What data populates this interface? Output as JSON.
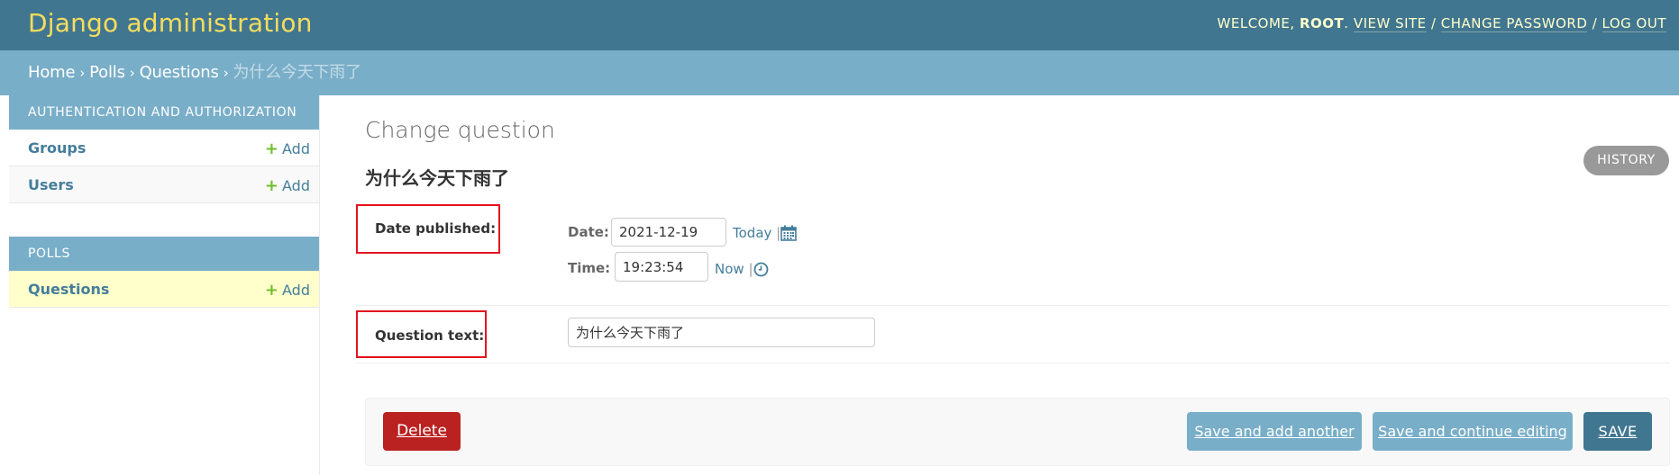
{
  "header": {
    "site_name": "Django administration",
    "welcome": "Welcome,",
    "username": "root",
    "view_site": "View site",
    "change_password": "Change password",
    "log_out": "Log out",
    "slash": "/",
    "period": "."
  },
  "breadcrumbs": {
    "home": "Home",
    "polls": "Polls",
    "questions": "Questions",
    "current": "为什么今天下雨了",
    "separator": "›"
  },
  "sidebar": {
    "modules": [
      {
        "caption": "Authentication and Authorization",
        "rows": [
          {
            "name": "Groups",
            "add": "Add"
          },
          {
            "name": "Users",
            "add": "Add"
          }
        ]
      },
      {
        "caption": "Polls",
        "rows": [
          {
            "name": "Questions",
            "add": "Add"
          }
        ]
      }
    ]
  },
  "main": {
    "title": "Change question",
    "object_name": "为什么今天下雨了",
    "history": "History",
    "fields": {
      "date_published": {
        "label": "Date published:",
        "date_label": "Date:",
        "date_value": "2021-12-19",
        "today": "Today",
        "time_label": "Time:",
        "time_value": "19:23:54",
        "now": "Now",
        "pipe": "|"
      },
      "question_text": {
        "label": "Question text:",
        "value": "为什么今天下雨了"
      }
    },
    "submit_row": {
      "delete": "Delete",
      "save_add_another": "Save and add another",
      "save_continue": "Save and continue editing",
      "save": "Save"
    }
  },
  "colors": {
    "header_bg": "#417690",
    "site_name": "#f5dd5d",
    "breadcrumb_bg": "#79aec8",
    "link": "#447e9b",
    "add_plus": "#70bf2b",
    "delete_bg": "#ba2121",
    "save_bg": "#417690",
    "secondary_btn_bg": "#79aec8",
    "highlight_border": "#e3121e",
    "selected_row": "#ffffcc"
  },
  "icons": [
    "plus-icon",
    "calendar-icon",
    "clock-icon"
  ]
}
